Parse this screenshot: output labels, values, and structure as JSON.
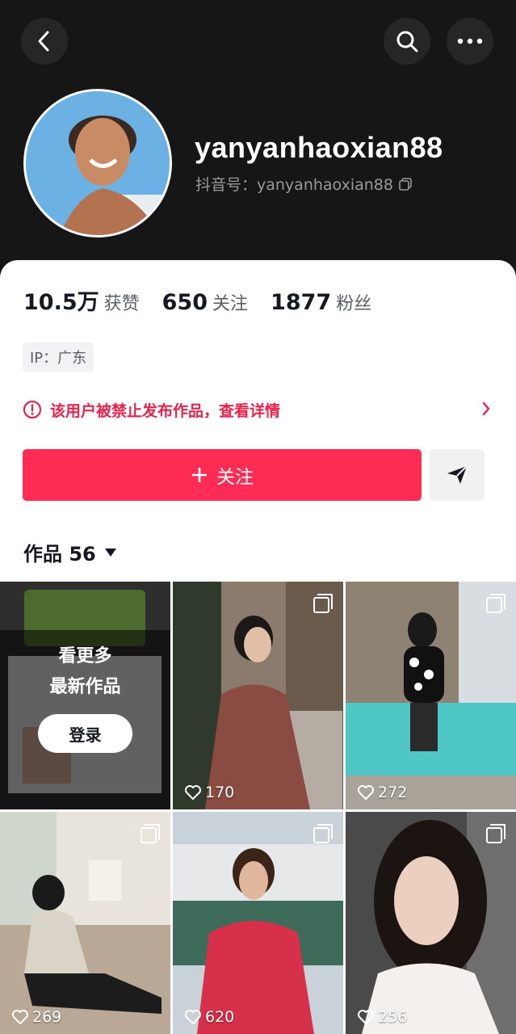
{
  "header": {
    "back_icon": "chevron-left-icon",
    "search_icon": "search-icon",
    "more_icon": "more-horizontal-icon"
  },
  "profile": {
    "username": "yanyanhaoxian88",
    "douyin_id": "抖音号：yanyanhaoxian88",
    "copy_icon": "copy-icon"
  },
  "stats": [
    {
      "value": "10.5万",
      "label": "获赞"
    },
    {
      "value": "650",
      "label": "关注"
    },
    {
      "value": "1877",
      "label": "粉丝"
    }
  ],
  "ip": "IP：广东",
  "ban_notice": "该用户被禁止发布作品，查看详情",
  "follow_label": "关注",
  "works_tab": "作品 56",
  "grid": {
    "overlay": {
      "line1": "看更多",
      "line2": "最新作品",
      "login_label": "登录"
    },
    "posts": [
      {
        "likes": "170"
      },
      {
        "likes": "272"
      },
      {
        "likes": "269"
      },
      {
        "likes": "620"
      },
      {
        "likes": "256"
      }
    ]
  },
  "colors": {
    "accent": "#fe2c55",
    "ban_text": "#e8234c",
    "header_bg": "#161616"
  }
}
